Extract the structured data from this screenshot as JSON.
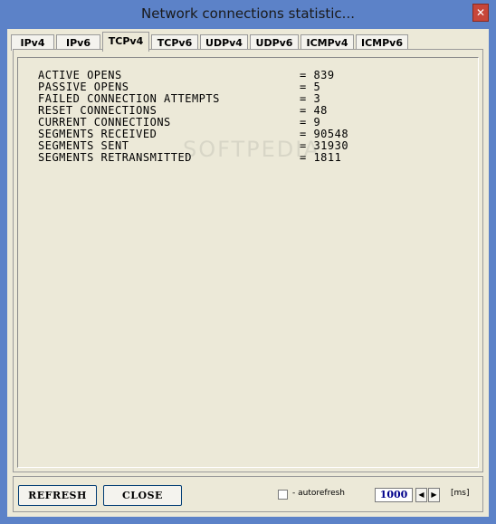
{
  "window": {
    "title": "Network connections statistic...",
    "close_glyph": "✕"
  },
  "tabs": [
    {
      "label": "IPv4",
      "active": false
    },
    {
      "label": "IPv6",
      "active": false
    },
    {
      "label": "TCPv4",
      "active": true
    },
    {
      "label": "TCPv6",
      "active": false
    },
    {
      "label": "UDPv4",
      "active": false
    },
    {
      "label": "UDPv6",
      "active": false
    },
    {
      "label": "ICMPv4",
      "active": false
    },
    {
      "label": "ICMPv6",
      "active": false
    }
  ],
  "stats": [
    {
      "label": "ACTIVE OPENS",
      "value": "= 839"
    },
    {
      "label": "PASSIVE OPENS",
      "value": "= 5"
    },
    {
      "label": "FAILED CONNECTION ATTEMPTS",
      "value": "= 3"
    },
    {
      "label": "RESET CONNECTIONS",
      "value": "= 48"
    },
    {
      "label": "CURRENT CONNECTIONS",
      "value": "= 9"
    },
    {
      "label": "SEGMENTS RECEIVED",
      "value": "= 90548"
    },
    {
      "label": "SEGMENTS SENT",
      "value": "= 31930"
    },
    {
      "label": "SEGMENTS RETRANSMITTED",
      "value": "= 1811"
    }
  ],
  "watermark": "SOFTPEDIA",
  "controls": {
    "refresh_label": "REFRESH",
    "close_label": "CLOSE",
    "autorefresh_label": "- autorefresh",
    "autorefresh_checked": false,
    "interval_value": "1000",
    "spin_left_glyph": "◀",
    "spin_right_glyph": "▶",
    "unit_label": "[ms]"
  }
}
